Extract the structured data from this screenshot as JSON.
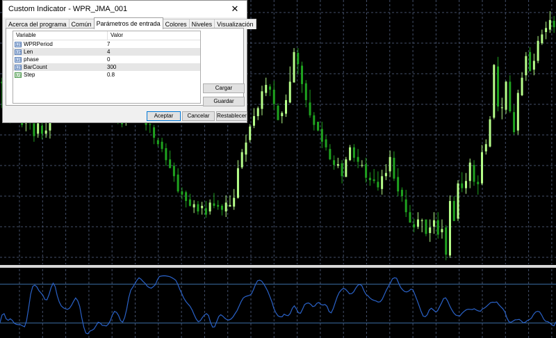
{
  "window": {
    "title": "Custom Indicator - WPR_JMA_001",
    "close_glyph": "✕"
  },
  "tabs": [
    {
      "label": "Acerca del programa",
      "active": false
    },
    {
      "label": "Común",
      "active": false
    },
    {
      "label": "Parámetros de entrada",
      "active": true
    },
    {
      "label": "Colores",
      "active": false
    },
    {
      "label": "Niveles",
      "active": false
    },
    {
      "label": "Visualización",
      "active": false
    }
  ],
  "params": {
    "header_variable": "Variable",
    "header_value": "Valor",
    "rows": [
      {
        "type_icon": "123",
        "name": "WPRPeriod",
        "value": "7"
      },
      {
        "type_icon": "123",
        "name": "Len",
        "value": "4"
      },
      {
        "type_icon": "123",
        "name": "phase",
        "value": "0"
      },
      {
        "type_icon": "123",
        "name": "BarCount",
        "value": "300"
      },
      {
        "type_icon": "1/2",
        "name": "Step",
        "value": "0.8"
      }
    ]
  },
  "buttons": {
    "load": "Cargar",
    "save": "Guardar",
    "ok": "Aceptar",
    "cancel": "Cancelar",
    "reset": "Restablecer"
  },
  "colors": {
    "background": "#000000",
    "bull_candle": "#b6ff8a",
    "bear_candle": "#1fa31f",
    "grid": "#44506a",
    "indicator_line": "#2a62c8",
    "separator": "#d8d8d8",
    "level_line": "#3b6ea5"
  },
  "chart_data": {
    "type": "candlestick",
    "candles": [
      [
        228,
        226,
        195,
        233
      ],
      [
        213,
        202,
        182,
        215
      ],
      [
        201,
        196,
        176,
        205
      ],
      [
        191,
        209,
        185,
        218
      ],
      [
        205,
        191,
        185,
        218
      ],
      [
        190,
        174,
        171,
        198
      ],
      [
        176,
        189,
        166,
        195
      ],
      [
        190,
        178,
        168,
        193
      ],
      [
        176,
        160,
        153,
        164
      ],
      [
        163,
        176,
        158,
        183
      ],
      [
        173,
        163,
        156,
        181
      ],
      [
        163,
        167,
        158,
        177
      ],
      [
        167,
        185,
        157,
        191
      ],
      [
        182,
        192,
        179,
        196
      ],
      [
        195,
        214,
        190,
        221
      ],
      [
        216,
        232,
        211,
        240
      ],
      [
        234,
        213,
        210,
        241
      ],
      [
        216,
        222,
        206,
        228
      ],
      [
        223,
        202,
        195,
        228
      ],
      [
        204,
        214,
        198,
        219
      ],
      [
        215,
        219,
        200,
        227
      ],
      [
        223,
        230,
        218,
        236
      ],
      [
        233,
        250,
        225,
        257
      ],
      [
        250,
        281,
        242,
        284
      ],
      [
        282,
        269,
        260,
        288
      ],
      [
        270,
        250,
        242,
        285
      ],
      [
        253,
        247,
        238,
        262
      ],
      [
        247,
        217,
        207,
        248
      ],
      [
        218,
        209,
        197,
        218
      ],
      [
        205,
        185,
        175,
        210
      ],
      [
        186,
        175,
        171,
        195
      ],
      [
        177,
        189,
        173,
        191
      ],
      [
        190,
        205,
        185,
        212
      ],
      [
        207,
        204,
        196,
        214
      ],
      [
        202,
        206,
        195,
        212
      ],
      [
        208,
        188,
        184,
        210
      ],
      [
        187,
        174,
        167,
        190
      ],
      [
        175,
        174,
        164,
        184
      ],
      [
        171,
        158,
        150,
        174
      ],
      [
        155,
        150,
        147,
        158
      ],
      [
        153,
        144,
        140,
        158
      ],
      [
        145,
        130,
        123,
        151
      ],
      [
        131,
        120,
        120,
        142
      ],
      [
        123,
        110,
        103,
        127
      ],
      [
        112,
        91,
        89,
        120
      ],
      [
        91,
        87,
        81,
        96
      ],
      [
        90,
        79,
        71,
        92
      ],
      [
        81,
        73,
        72,
        88
      ],
      [
        71,
        75,
        64,
        80
      ],
      [
        75,
        66,
        62,
        79
      ],
      [
        70,
        73,
        62,
        78
      ],
      [
        70,
        62,
        58,
        79
      ],
      [
        66,
        77,
        62,
        81
      ],
      [
        76,
        73,
        70,
        89
      ],
      [
        74,
        72,
        68,
        80
      ],
      [
        73,
        68,
        61,
        75
      ],
      [
        66,
        77,
        59,
        86
      ],
      [
        72,
        74,
        72,
        86
      ],
      [
        72,
        83,
        68,
        94
      ],
      [
        83,
        120,
        82,
        130
      ],
      [
        121,
        140,
        119,
        144
      ],
      [
        137,
        152,
        128,
        162
      ],
      [
        155,
        172,
        152,
        175
      ],
      [
        173,
        185,
        170,
        195
      ],
      [
        185,
        195,
        180,
        197
      ],
      [
        194,
        216,
        186,
        223
      ],
      [
        214,
        224,
        210,
        233
      ],
      [
        222,
        218,
        210,
        225
      ],
      [
        218,
        200,
        193,
        229
      ],
      [
        198,
        180,
        180,
        201
      ],
      [
        185,
        189,
        176,
        191
      ],
      [
        188,
        205,
        184,
        212
      ],
      [
        202,
        228,
        201,
        247
      ],
      [
        227,
        265,
        227,
        270
      ],
      [
        264,
        250,
        237,
        270
      ],
      [
        248,
        225,
        214,
        253
      ],
      [
        226,
        205,
        196,
        230
      ],
      [
        202,
        186,
        183,
        218
      ],
      [
        186,
        174,
        167,
        190
      ],
      [
        178,
        167,
        166,
        178
      ],
      [
        169,
        153,
        145,
        178
      ],
      [
        156,
        146,
        142,
        161
      ],
      [
        144,
        131,
        130,
        150
      ],
      [
        130,
        124,
        118,
        136
      ],
      [
        123,
        125,
        120,
        133
      ],
      [
        126,
        110,
        101,
        130
      ],
      [
        109,
        131,
        109,
        134
      ],
      [
        130,
        146,
        129,
        149
      ],
      [
        146,
        133,
        128,
        150
      ],
      [
        134,
        128,
        120,
        144
      ],
      [
        123,
        124,
        121,
        130
      ],
      [
        125,
        108,
        102,
        133
      ],
      [
        108,
        105,
        98,
        115
      ],
      [
        106,
        104,
        101,
        119
      ],
      [
        103,
        96,
        92,
        116
      ],
      [
        94,
        110,
        87,
        118
      ],
      [
        110,
        114,
        105,
        125
      ],
      [
        116,
        134,
        109,
        142
      ],
      [
        133,
        107,
        104,
        141
      ],
      [
        109,
        91,
        85,
        120
      ],
      [
        93,
        85,
        78,
        96
      ],
      [
        81,
        65,
        59,
        93
      ],
      [
        65,
        52,
        52,
        74
      ],
      [
        50,
        46,
        40,
        57
      ],
      [
        47,
        56,
        44,
        65
      ],
      [
        54,
        55,
        40,
        57
      ],
      [
        56,
        38,
        35,
        56
      ],
      [
        39,
        46,
        28,
        56
      ],
      [
        47,
        55,
        38,
        65
      ],
      [
        55,
        37,
        32,
        65
      ],
      [
        40,
        44,
        32,
        56
      ],
      [
        46,
        12,
        5,
        49
      ],
      [
        11,
        79,
        8,
        86
      ],
      [
        79,
        54,
        54,
        85
      ],
      [
        57,
        101,
        54,
        105
      ],
      [
        101,
        95,
        90,
        115
      ],
      [
        95,
        104,
        88,
        114
      ],
      [
        104,
        127,
        95,
        132
      ],
      [
        124,
        103,
        98,
        130
      ],
      [
        103,
        100,
        87,
        111
      ],
      [
        101,
        140,
        99,
        149
      ],
      [
        141,
        150,
        137,
        156
      ],
      [
        147,
        181,
        146,
        185
      ],
      [
        183,
        249,
        181,
        250
      ],
      [
        247,
        197,
        191,
        259
      ],
      [
        195,
        196,
        181,
        208
      ],
      [
        193,
        228,
        188,
        229
      ],
      [
        228,
        191,
        189,
        236
      ],
      [
        190,
        165,
        162,
        199
      ],
      [
        167,
        214,
        162,
        218
      ],
      [
        211,
        233,
        210,
        240
      ],
      [
        236,
        260,
        229,
        265
      ],
      [
        265,
        241,
        241,
        271
      ],
      [
        243,
        254,
        236,
        263
      ],
      [
        254,
        279,
        251,
        285
      ],
      [
        276,
        287,
        274,
        293
      ],
      [
        290,
        295,
        281,
        303
      ],
      [
        293,
        305,
        289,
        316
      ],
      [
        304,
        296,
        289,
        310
      ]
    ],
    "indicator_line": [
      20.5,
      32.3,
      34.4,
      26.5,
      24.1,
      26.5,
      24.2,
      19.6,
      17.9,
      17.3,
      17.4,
      15.6,
      14.1,
      23.4,
      43.1,
      64.4,
      76.6,
      78.5,
      76,
      70.1,
      66.7,
      62.7,
      56.2,
      55.8,
      64.1,
      74.8,
      81.5,
      76.1,
      61.9,
      52.4,
      46.3,
      43.4,
      42,
      41,
      42.8,
      47.3,
      53.6,
      58.7,
      54.5,
      45.5,
      28.5,
      13.6,
      4.4,
      3.3,
      7.5,
      8.7,
      10.9,
      15.8,
      21.2,
      20,
      16.3,
      16.2,
      15.4,
      18.2,
      23.8,
      32.5,
      37.8,
      36.5,
      31.5,
      23.6,
      21.3,
      28.4,
      41.9,
      59.3,
      70.7,
      75.6,
      80.7,
      86.2,
      89.9,
      87.6,
      84.1,
      81.3,
      77,
      74.7,
      73.9,
      76.1,
      79.3,
      86.8,
      91.9,
      92.6,
      93,
      92.9,
      92.4,
      91.7,
      90.1,
      88.3,
      86,
      79.6,
      71.8,
      64.8,
      58,
      53.1,
      49.3,
      45.7,
      40,
      32.7,
      25.9,
      21.9,
      23.4,
      28.4,
      32.4,
      34.4,
      31.6,
      20.8,
      13.6,
      14,
      22,
      30,
      32.8,
      30.5,
      27.4,
      25.1,
      24.6,
      26.1,
      29.5,
      34.4,
      39.4,
      46.2,
      53.3,
      58.6,
      60.8,
      61.8,
      62.7,
      65,
      71.6,
      79.5,
      85.3,
      86.1,
      84.7,
      80.4,
      74.9,
      68.9,
      61.1,
      52.8,
      42.4,
      35.5,
      31.1,
      29.6,
      29.6,
      33.6,
      31.9,
      31.4,
      34.7,
      42.7,
      46.5,
      41.5,
      35.8,
      35,
      41.3,
      48.4,
      50.4,
      51,
      48.8,
      45.4,
      46.2,
      50.4,
      51.7,
      48.6,
      47.7,
      48.6,
      45.7,
      37.6,
      35.6,
      42,
      51.6,
      60.7,
      67.4,
      71.2,
      73.6,
      72.1,
      68.9,
      65.1,
      65.4,
      68.1,
      73.8,
      78.1,
      79.7,
      77.7,
      70.3,
      64.4,
      62,
      58.5,
      56.2,
      55,
      54,
      52.3,
      52.9,
      56.7,
      63.5,
      70.8,
      76.5,
      82.2,
      88.4,
      89.9,
      89.3,
      81.8,
      74.9,
      71.2,
      68.5,
      68.1,
      69.4,
      72.3,
      71.4,
      63.5,
      55.6,
      47,
      37.8,
      30.8,
      29.7,
      32.7,
      40,
      42.8,
      40.3,
      37.3,
      38.5,
      44.8,
      50.9,
      57.6,
      58.9,
      54,
      46.5,
      40.5,
      35.5,
      32.2,
      31.3,
      31.1,
      34.9,
      37.8,
      40.2,
      41.3,
      41.1,
      40.8,
      42,
      40.1,
      38.7,
      38.1,
      41.5,
      43.1,
      45.6,
      48.6,
      51.4,
      52.1,
      51.8,
      52.5,
      48.6,
      45,
      42,
      37.1,
      27.7,
      21.8,
      21.1,
      22.9,
      24.8,
      25.1,
      25.5,
      23.2,
      20.2,
      21.3,
      23.9,
      25.3,
      27.6,
      33.1,
      36.9,
      38.1,
      37.1,
      32.3,
      25.8,
      22.5,
      22.1,
      20,
      17.1,
      15.6,
      21.9
    ]
  }
}
